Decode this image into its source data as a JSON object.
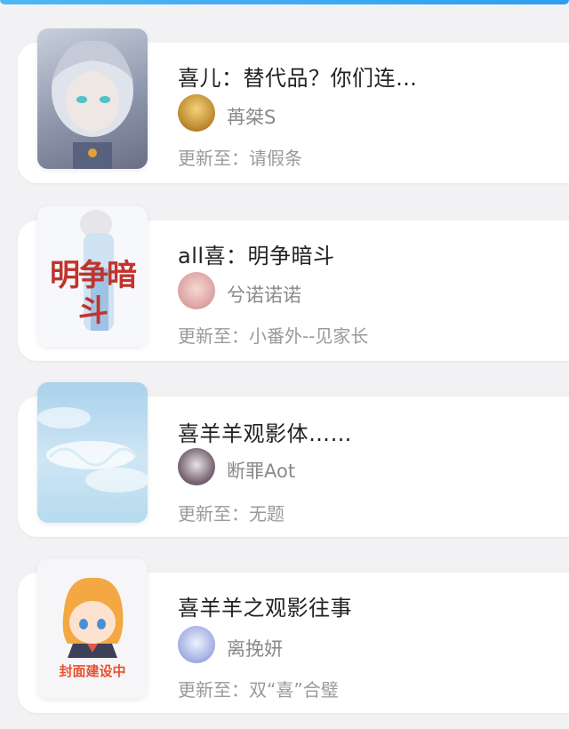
{
  "colors": {
    "accent": "#2e9ff0",
    "card_bg": "#ffffff",
    "page_bg": "#f2f2f4"
  },
  "books": [
    {
      "title": "喜儿：替代品？你们连…",
      "author": "苒桀S",
      "update_prefix": "更新至：",
      "update_chapter": "请假条",
      "cover_icon": "silver-haired-boy-cover",
      "avatar_icon": "golden-avatar"
    },
    {
      "title": "all喜：明争暗斗",
      "author": "兮诺诺诺",
      "update_prefix": "更新至：",
      "update_chapter": "小番外--见家长",
      "cover_icon": "book-cover-title-art",
      "cover_text": "明争暗斗",
      "avatar_icon": "pink-hair-avatar"
    },
    {
      "title": "喜羊羊观影体……",
      "author": "断罪Aot",
      "update_prefix": "更新至：",
      "update_chapter": "无题",
      "cover_icon": "sky-watercolor-cover",
      "avatar_icon": "dark-hair-avatar"
    },
    {
      "title": "喜羊羊之观影往事",
      "author": "离挽妍",
      "update_prefix": "更新至：",
      "update_chapter": "双“喜”合璧",
      "cover_icon": "placeholder-chibi-cover",
      "cover_text": "封面建设中",
      "avatar_icon": "blue-hair-avatar"
    }
  ]
}
